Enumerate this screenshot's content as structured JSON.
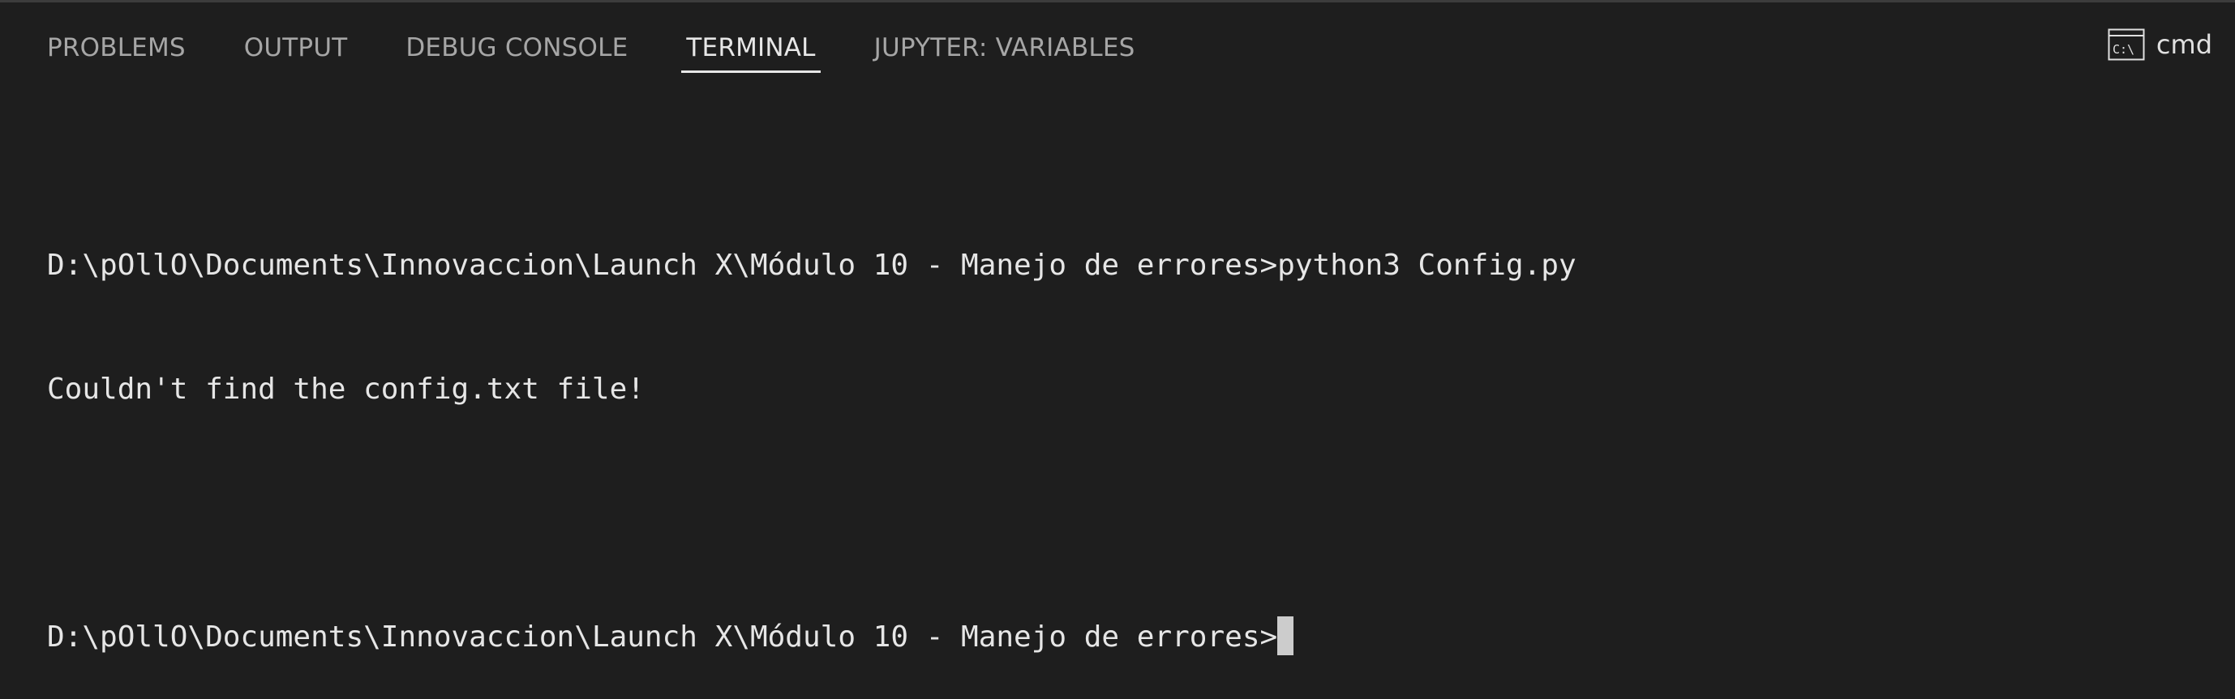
{
  "panel": {
    "tabs": [
      {
        "label": "PROBLEMS",
        "active": false
      },
      {
        "label": "OUTPUT",
        "active": false
      },
      {
        "label": "DEBUG CONSOLE",
        "active": false
      },
      {
        "label": "TERMINAL",
        "active": true
      },
      {
        "label": "JUPYTER: VARIABLES",
        "active": false
      }
    ],
    "shell": {
      "icon": "terminal-cmd-icon",
      "icon_text": "C:\\",
      "label": "cmd"
    }
  },
  "terminal": {
    "lines": [
      "D:\\pOllO\\Documents\\Innovaccion\\Launch X\\Módulo 10 - Manejo de errores>python3 Config.py",
      "Couldn't find the config.txt file!",
      "",
      "D:\\pOllO\\Documents\\Innovaccion\\Launch X\\Módulo 10 - Manejo de errores>"
    ]
  },
  "colors": {
    "background": "#1e1e1e",
    "active_tab": "#e7e7e7",
    "inactive_tab": "#a6a6a6",
    "terminal_text": "#e6e6e6",
    "cursor": "#cccccc"
  }
}
